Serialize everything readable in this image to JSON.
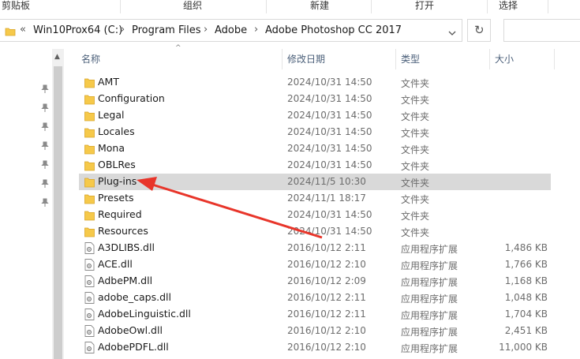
{
  "ribbon": {
    "clipboard": "剪贴板",
    "organize": "组织",
    "new": "新建",
    "open": "打开",
    "select": "选择"
  },
  "address": {
    "overflow": "«",
    "crumbs": [
      "Win10Prox64 (C:)",
      "Program Files",
      "Adobe",
      "Adobe Photoshop CC 2017"
    ],
    "separator": "›",
    "dropdown_icon": "chevron-down-icon",
    "refresh_icon": "refresh-icon"
  },
  "columns": {
    "name": "名称",
    "date": "修改日期",
    "type": "类型",
    "size": "大小"
  },
  "files": [
    {
      "name": "AMT",
      "date": "2024/10/31 14:50",
      "type": "文件夹",
      "size": "",
      "kind": "folder"
    },
    {
      "name": "Configuration",
      "date": "2024/10/31 14:50",
      "type": "文件夹",
      "size": "",
      "kind": "folder"
    },
    {
      "name": "Legal",
      "date": "2024/10/31 14:50",
      "type": "文件夹",
      "size": "",
      "kind": "folder"
    },
    {
      "name": "Locales",
      "date": "2024/10/31 14:50",
      "type": "文件夹",
      "size": "",
      "kind": "folder"
    },
    {
      "name": "Mona",
      "date": "2024/10/31 14:50",
      "type": "文件夹",
      "size": "",
      "kind": "folder"
    },
    {
      "name": "OBLRes",
      "date": "2024/10/31 14:50",
      "type": "文件夹",
      "size": "",
      "kind": "folder"
    },
    {
      "name": "Plug-ins",
      "date": "2024/11/5 10:30",
      "type": "文件夹",
      "size": "",
      "kind": "folder",
      "selected": true
    },
    {
      "name": "Presets",
      "date": "2024/11/1 18:17",
      "type": "文件夹",
      "size": "",
      "kind": "folder"
    },
    {
      "name": "Required",
      "date": "2024/10/31 14:50",
      "type": "文件夹",
      "size": "",
      "kind": "folder"
    },
    {
      "name": "Resources",
      "date": "2024/10/31 14:50",
      "type": "文件夹",
      "size": "",
      "kind": "folder"
    },
    {
      "name": "A3DLIBS.dll",
      "date": "2016/10/12 2:11",
      "type": "应用程序扩展",
      "size": "1,486 KB",
      "kind": "dll"
    },
    {
      "name": "ACE.dll",
      "date": "2016/10/12 2:10",
      "type": "应用程序扩展",
      "size": "1,766 KB",
      "kind": "dll"
    },
    {
      "name": "AdbePM.dll",
      "date": "2016/10/12 2:09",
      "type": "应用程序扩展",
      "size": "1,168 KB",
      "kind": "dll"
    },
    {
      "name": "adobe_caps.dll",
      "date": "2016/10/12 2:11",
      "type": "应用程序扩展",
      "size": "1,048 KB",
      "kind": "dll"
    },
    {
      "name": "AdobeLinguistic.dll",
      "date": "2016/10/12 2:11",
      "type": "应用程序扩展",
      "size": "1,704 KB",
      "kind": "dll"
    },
    {
      "name": "AdobeOwl.dll",
      "date": "2016/10/12 2:10",
      "type": "应用程序扩展",
      "size": "2,451 KB",
      "kind": "dll"
    },
    {
      "name": "AdobePDFL.dll",
      "date": "2016/10/12 2:10",
      "type": "应用程序扩展",
      "size": "11,000 KB",
      "kind": "dll"
    }
  ],
  "colors": {
    "folder": "#f6c94a",
    "selection": "#d9d9d9",
    "annotation_arrow": "#e8352a"
  }
}
